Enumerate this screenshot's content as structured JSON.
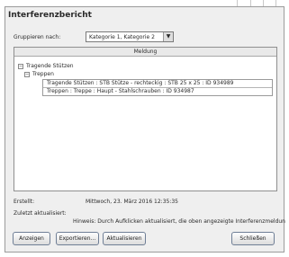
{
  "dialog": {
    "title": "Interferenzbericht",
    "group_by_label": "Gruppieren nach:",
    "group_by_value": "Kategorie 1, Kategorie 2"
  },
  "tree": {
    "column_header": "Meldung",
    "nodes": [
      {
        "label": "Tragende Stützen",
        "expanded": true
      },
      {
        "label": "Treppen",
        "expanded": true
      },
      {
        "label": "Tragende Stützen : STB Stütze - rechteckig : STB 25 x 25 : ID 934989"
      },
      {
        "label": "Treppen : Treppe : Haupt - Stahlschrauben : ID 934987"
      }
    ]
  },
  "info": {
    "created_label": "Erstellt:",
    "created_value": "Mittwoch, 23. März 2016 12:35:35",
    "updated_label": "Zuletzt aktualisiert:",
    "note": "Hinweis: Durch Aufklicken aktualisiert, die oben angezeigte Interferenzmeldun"
  },
  "buttons": {
    "show": "Anzeigen",
    "export": "Exportieren...",
    "refresh": "Aktualisieren",
    "close": "Schließen"
  }
}
